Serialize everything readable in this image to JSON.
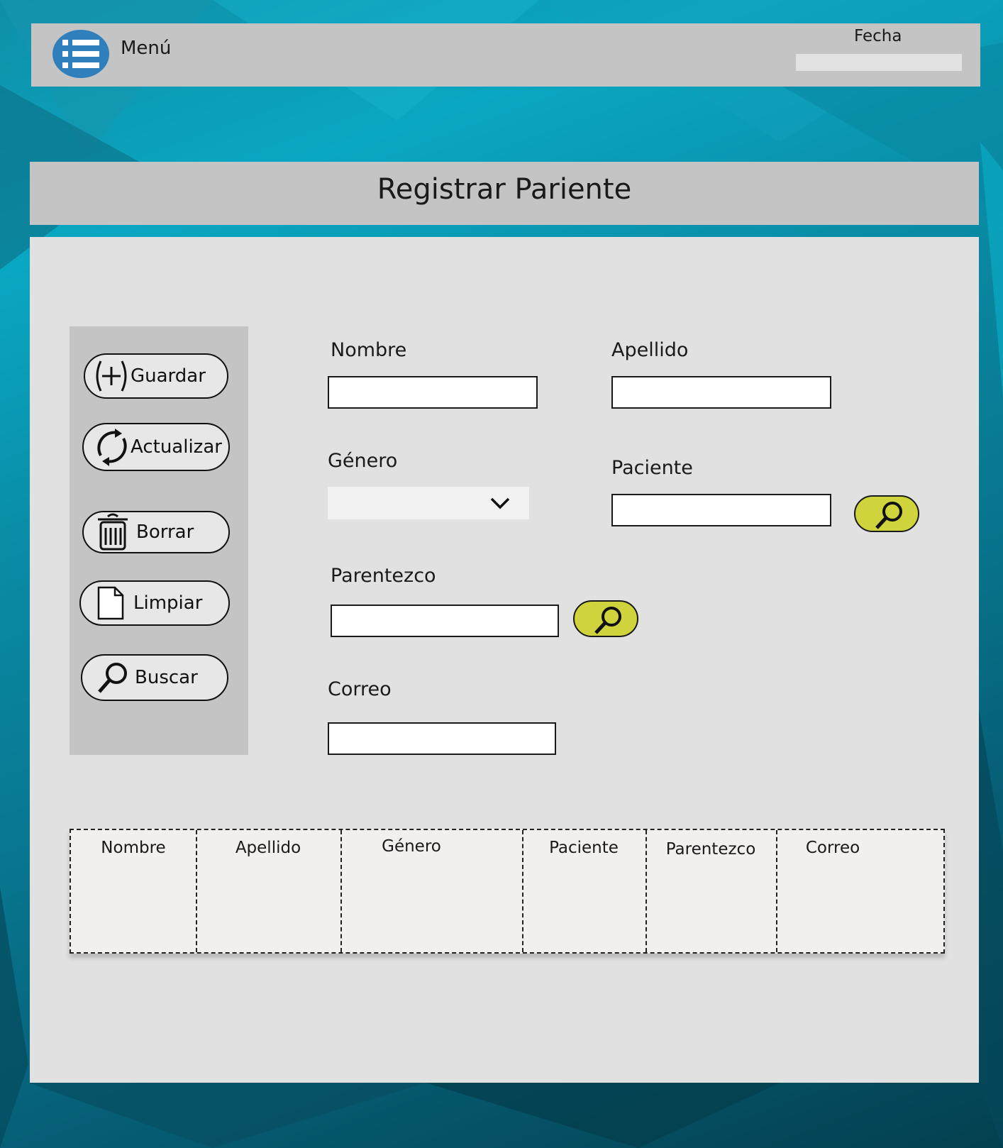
{
  "header": {
    "menu_label": "Menú",
    "menu_icon": "list-icon",
    "date_label": "Fecha",
    "date_value": ""
  },
  "page": {
    "title": "Registrar Pariente"
  },
  "sidebar": {
    "buttons": [
      {
        "label": "Guardar",
        "icon": "plus-circle-icon"
      },
      {
        "label": "Actualizar",
        "icon": "refresh-icon"
      },
      {
        "label": "Borrar",
        "icon": "trash-icon"
      },
      {
        "label": "Limpiar",
        "icon": "document-icon"
      },
      {
        "label": "Buscar",
        "icon": "search-icon"
      }
    ]
  },
  "form": {
    "nombre": {
      "label": "Nombre",
      "value": ""
    },
    "apellido": {
      "label": "Apellido",
      "value": ""
    },
    "genero": {
      "label": "Género",
      "value": ""
    },
    "paciente": {
      "label": "Paciente",
      "value": ""
    },
    "parentezco": {
      "label": "Parentezco",
      "value": ""
    },
    "correo": {
      "label": "Correo",
      "value": ""
    }
  },
  "table": {
    "columns": [
      "Nombre",
      "Apellido",
      "Género",
      "Paciente",
      "Parentezco",
      "Correo"
    ],
    "rows": []
  },
  "colors": {
    "search_button": "#cfd43d",
    "menu_icon_bg": "#2f7fbd",
    "bar_gray": "#c4c4c4",
    "panel_gray": "#e1e1e1"
  }
}
